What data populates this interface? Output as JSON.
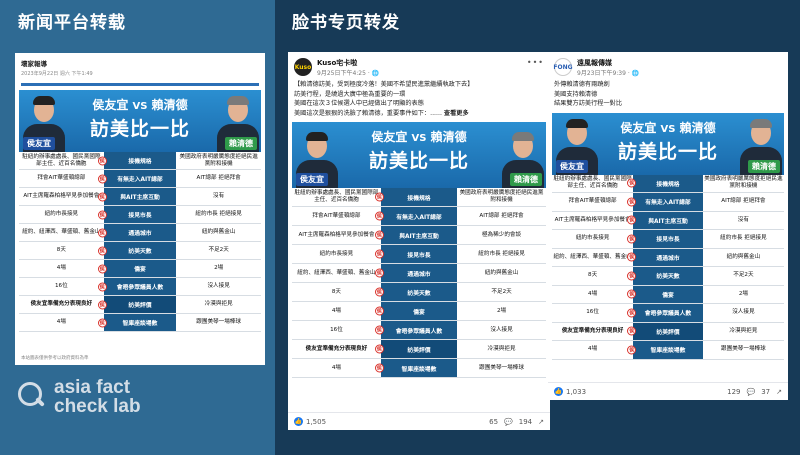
{
  "headings": {
    "news": "新闻平台转载",
    "facebook": "脸书专页转发"
  },
  "news_card": {
    "source": "壞家報導",
    "date": "2023年9月22日 週六 下午1:49",
    "footer_note": "本站圖表僅供參考以政府資料為準"
  },
  "post_mid": {
    "page_name": "Kuso宅卡啦",
    "avatar_text": "Kuso",
    "time": "9月25日下午4:25 · 🌐",
    "text_lines": [
      "【賴清德訪美，受到極度冷落！美國不希望民進黨繼續執政下去】",
      "訪美行程，是繞過大廣中極為重要的一環",
      "美國在這次３位候選人中已經做出了明顯的表態",
      "美國這次是狠狠的洗臉了賴清德，重要事件如下：......"
    ],
    "see_more": "查看更多",
    "reaction_count": "1,505",
    "comment_count": "65",
    "share_count": "194"
  },
  "post_right": {
    "page_name": "遠風報傳媒",
    "avatar_text": "FONG",
    "time": "9月23日下午9:39 · 🌐",
    "text_lines": [
      "外傳賴清德有兩蹺劍",
      "美國支持賴清德",
      "結果雙方訪美行程一對比"
    ],
    "reaction_count": "1,033",
    "comment_count": "129",
    "share_count": "37"
  },
  "graphic": {
    "title_left": "侯友宜",
    "vs": "VS",
    "title_right": "賴清德",
    "main_title": "訪美比一比",
    "tag_left": "侯友宜",
    "tag_right": "賴清德",
    "seal": "侯",
    "rows": [
      {
        "left": "駐紐約辦事處處長、國民黨國際部主任、近百名僑胞",
        "mid": "接機規格",
        "right": "美國政府表明嚴厲態度拒絕民進黨附和接機"
      },
      {
        "left": "拜會AIT華盛頓總部",
        "mid": "有無走入AIT總部",
        "right": "AIT總部 拒絕拜會"
      },
      {
        "left": "AIT主席羅森柏格罕見參加餐會",
        "mid": "與AIT主席互動",
        "right": "沒有"
      },
      {
        "left": "紐約市長接見",
        "mid": "接見市長",
        "right": "紐約市長 拒絕接見"
      },
      {
        "left": "紐約、紐澤西、華盛頓、舊金山",
        "mid": "通過城市",
        "right": "紐約與舊金山"
      },
      {
        "left": "8天",
        "mid": "訪美天數",
        "right": "不足2天"
      },
      {
        "left": "4場",
        "mid": "僑宴",
        "right": "2場"
      },
      {
        "left": "16位",
        "mid": "會晤參眾議員人數",
        "right": "沒人接見"
      },
      {
        "left": "侯友宜準備充分表現良好",
        "mid": "訪美評價",
        "right": "冷漠與拒見"
      },
      {
        "left": "4場",
        "mid": "智庫座談場數",
        "right": "跟團美琴一場棒球"
      }
    ],
    "mid_rows": [
      {
        "left": "駐紐約辦事處處長、國民黨國際部主任、近百名僑胞",
        "mid": "接機規格",
        "right": "美國政府表明嚴厲態度拒絕民進黨附和接機"
      },
      {
        "left": "拜會AIT華盛頓總部",
        "mid": "有無走入AIT總部",
        "right": "AIT總部 拒絕拜會"
      },
      {
        "left": "AIT主席羅森柏格罕見參加餐會",
        "mid": "與AIT主席互動",
        "right": "極為稀少的會談"
      },
      {
        "left": "紐約市長接見",
        "mid": "接見市長",
        "right": "紐約市長 拒絕接見"
      },
      {
        "left": "紐約、紐澤西、華盛頓、舊金山",
        "mid": "通過城市",
        "right": "紐約與舊金山"
      },
      {
        "left": "8天",
        "mid": "訪美天數",
        "right": "不足2天"
      },
      {
        "left": "4場",
        "mid": "僑宴",
        "right": "2場"
      },
      {
        "left": "16位",
        "mid": "會晤參眾議員人數",
        "right": "沒人接見"
      },
      {
        "left": "侯友宜準備充分表現良好",
        "mid": "訪美評價",
        "right": "冷漠與拒見"
      },
      {
        "left": "4場",
        "mid": "智庫座談場數",
        "right": "跟團美琴一場棒球"
      }
    ]
  },
  "logo": {
    "line1": "asia fact",
    "line2": "check lab"
  },
  "colors": {
    "left_bg": "#2f6a93",
    "right_bg": "#173a57",
    "table_mid": "#1b5a8a",
    "seal_red": "#d9322b"
  }
}
